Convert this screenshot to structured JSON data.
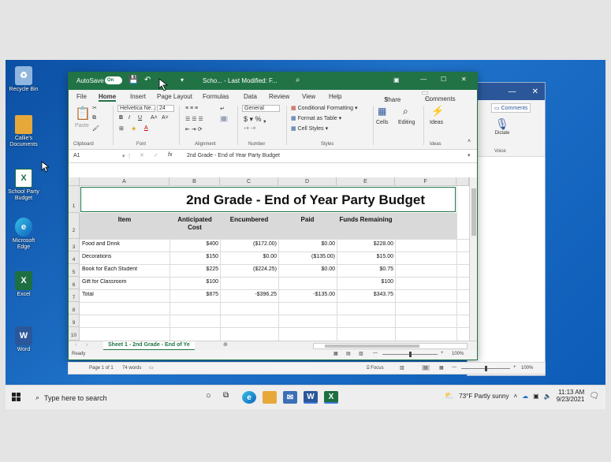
{
  "desktop": {
    "icons": [
      {
        "label": "Recycle Bin",
        "icon": "recycle-bin-icon"
      },
      {
        "label": "Callie's Documents",
        "icon": "folder-icon"
      },
      {
        "label": "School Party Budget",
        "icon": "excel-file-icon"
      },
      {
        "label": "Microsoft Edge",
        "icon": "edge-icon"
      },
      {
        "label": "Excel",
        "icon": "excel-icon"
      },
      {
        "label": "Word",
        "icon": "word-icon"
      }
    ]
  },
  "excel": {
    "autosave_label": "AutoSave",
    "autosave_state": "On",
    "doc_title": "Scho... - Last Modified: F...",
    "share_label": "Share",
    "comments_label": "Comments",
    "tabs": [
      "File",
      "Home",
      "Insert",
      "Page Layout",
      "Formulas",
      "Data",
      "Review",
      "View",
      "Help"
    ],
    "active_tab": "Home",
    "ribbon": {
      "font_name": "Helvetica Ne...",
      "font_size": "24",
      "number_format": "General",
      "paste_label": "Paste",
      "conditional_formatting": "Conditional Formatting",
      "format_as_table": "Format as Table",
      "cell_styles": "Cell Styles",
      "cells_label": "Cells",
      "editing_label": "Editing",
      "ideas_label": "Ideas",
      "groups": [
        "Clipboard",
        "Font",
        "Alignment",
        "Number",
        "Styles",
        "Ideas"
      ]
    },
    "name_box": "A1",
    "formula": "2nd Grade - End of Year Party Budget",
    "columns": [
      "A",
      "B",
      "C",
      "D",
      "E",
      "F"
    ],
    "rows": [
      "1",
      "2",
      "3",
      "4",
      "5",
      "6",
      "7",
      "8",
      "9",
      "10"
    ],
    "sheet": {
      "title": "2nd Grade - End of Year Party Budget",
      "headers": [
        "Item",
        "Anticipated Cost",
        "Encumbered",
        "Paid",
        "Funds Remaining"
      ],
      "data": [
        [
          "Food and Drink",
          "$400",
          "($172.00)",
          "$0.00",
          "$228.00"
        ],
        [
          "Decorations",
          "$150",
          "$0.00",
          "($135.00)",
          "$15.00"
        ],
        [
          "Book for Each Student",
          "$225",
          "($224.25)",
          "$0.00",
          "$0.75"
        ],
        [
          "Gift for Classroom",
          "$100",
          "",
          "",
          "$100"
        ],
        [
          "Total",
          "$875",
          "-$396.25",
          "-$135.00",
          "$343.75"
        ]
      ]
    },
    "sheet_tab": "Sheet 1 - 2nd Grade - End of Ye",
    "status_ready": "Ready",
    "zoom": "100%"
  },
  "word": {
    "comments_label": "Comments",
    "dictate_label": "Dictate",
    "voice_label": "Voice",
    "page_info": "Page 1 of 1",
    "words": "74 words",
    "focus_label": "Focus",
    "zoom": "100%"
  },
  "taskbar": {
    "search_placeholder": "Type here to search",
    "weather": "73°F  Partly sunny",
    "time": "11:13 AM",
    "date": "9/23/2021"
  }
}
